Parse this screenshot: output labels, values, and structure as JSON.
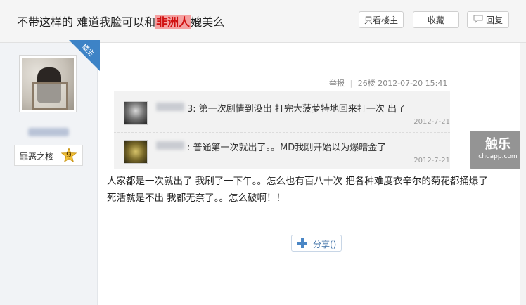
{
  "thread": {
    "title_before": "不带这样的 难道我脸可以和",
    "title_highlight": "非洲人",
    "title_after": "媲美么"
  },
  "header_buttons": {
    "only_op": "只看楼主",
    "favorite": "收藏",
    "reply": "回复"
  },
  "author": {
    "op_badge": "楼主",
    "rank_title": "罪恶之核",
    "rank_level": "9"
  },
  "post": {
    "report": "举报",
    "floor": "26楼",
    "datetime": "2012-07-20 15:41",
    "body_line1": "人家都是一次就出了 我刷了一下午。。怎么也有百八十次 把各种难度衣辛尔的菊花都捅爆了",
    "body_line2": "死活就是不出 我都无奈了。。怎么破啊！！"
  },
  "comments": [
    {
      "name_suffix": "3:",
      "text": "第一次剧情到没出 打完大菠萝特地回来打一次 出了",
      "date": "2012-7-21"
    },
    {
      "name_suffix": ":",
      "text": "普通第一次就出了。。MD我刚开始以为爆暗金了",
      "date": "2012-7-21"
    }
  ],
  "share": {
    "label": "分享()"
  },
  "watermark": {
    "brand": "触乐",
    "site": "chuapp.com"
  },
  "colors": {
    "op_badge": "#3d83c6",
    "highlight_bg": "#f4a0a0",
    "highlight_text": "#d01010"
  },
  "icons": {
    "reply": "speech-bubble-icon",
    "share": "plus-icon",
    "rank": "star-badge-icon"
  }
}
